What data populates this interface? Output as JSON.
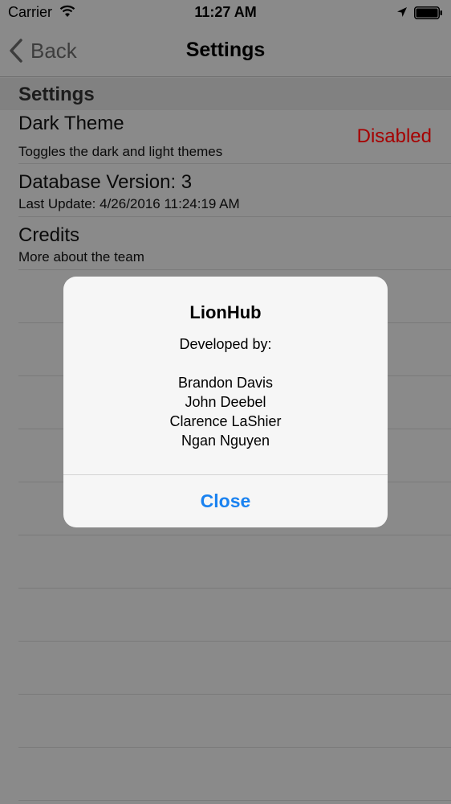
{
  "status_bar": {
    "carrier": "Carrier",
    "time": "11:27 AM",
    "icons": [
      "wifi-icon",
      "location-arrow-icon",
      "battery-icon"
    ]
  },
  "nav": {
    "back_label": "Back",
    "title": "Settings"
  },
  "section": {
    "header": "Settings"
  },
  "rows": [
    {
      "title": "Dark Theme",
      "subtitle": "Toggles the dark and light themes",
      "value": "Disabled"
    },
    {
      "title": "Database Version: 3",
      "subtitle": "Last Update: 4/26/2016 11:24:19 AM"
    },
    {
      "title": "Credits",
      "subtitle": "More about the team"
    }
  ],
  "alert": {
    "title": "LionHub",
    "message_heading": "Developed by:",
    "names": [
      "Brandon Davis",
      "John Deebel",
      "Clarence LaShier",
      "Ngan Nguyen"
    ],
    "button_label": "Close"
  },
  "colors": {
    "accent": "#1a82f0",
    "disabled_value": "#a60000",
    "overlay_background": "#8a8a8a",
    "alert_background": "#f6f6f6"
  }
}
